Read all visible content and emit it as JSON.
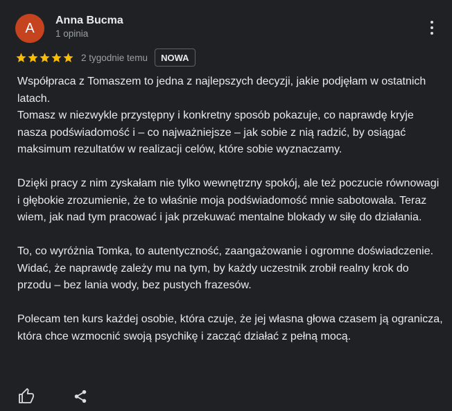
{
  "review": {
    "avatar_letter": "A",
    "author": "Anna Bucma",
    "author_meta": "1 opinia",
    "rating": 5,
    "max_rating": 5,
    "time_ago": "2 tygodnie temu",
    "badge": "NOWA",
    "paragraphs": [
      "Współpraca z Tomaszem to jedna z najlepszych decyzji, jakie podjęłam w ostatnich latach.",
      "Tomasz w niezwykle przystępny i konkretny sposób pokazuje, co naprawdę kryje nasza podświadomość i – co najważniejsze – jak sobie z nią radzić, by osiągać maksimum rezultatów w realizacji celów, które sobie wyznaczamy.",
      "Dzięki pracy z nim zyskałam nie tylko wewnętrzny spokój, ale też poczucie równowagi i głębokie zrozumienie, że to właśnie moja podświadomość mnie sabotowała. Teraz wiem, jak nad tym pracować i jak przekuwać mentalne blokady w siłę do działania.",
      "To, co wyróżnia Tomka, to autentyczność, zaangażowanie i ogromne doświadczenie. Widać, że naprawdę zależy mu na tym, by każdy uczestnik zrobił realny krok do przodu – bez lania wody, bez pustych frazesów.",
      "Polecam ten kurs każdej osobie, która czuje, że jej własna głowa czasem ją ogranicza, która chce wzmocnić swoją psychikę i zacząć działać z pełną mocą."
    ]
  },
  "icons": {
    "more": "more-vert-icon",
    "star": "star-icon",
    "like": "thumb-up-icon",
    "share": "share-icon"
  },
  "colors": {
    "background": "#202124",
    "avatar": "#c5431f",
    "star": "#fbbc04",
    "text": "#e8eaed",
    "muted": "#9aa0a6"
  }
}
